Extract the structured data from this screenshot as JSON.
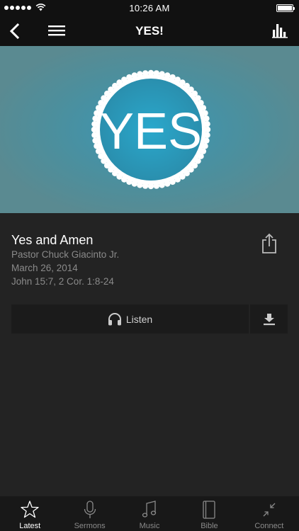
{
  "status": {
    "time": "10:26 AM"
  },
  "nav": {
    "title": "YES!"
  },
  "artwork": {
    "text": "YES",
    "background": "#568890",
    "circle": "#2e9fbf"
  },
  "sermon": {
    "title": "Yes and Amen",
    "speaker": "Pastor Chuck Giacinto Jr.",
    "date": "March 26, 2014",
    "scripture": "John 15:7, 2 Cor. 1:8-24",
    "listen_label": "Listen"
  },
  "tabs": [
    {
      "label": "Latest",
      "icon": "star-icon",
      "active": true
    },
    {
      "label": "Sermons",
      "icon": "microphone-icon",
      "active": false
    },
    {
      "label": "Music",
      "icon": "music-note-icon",
      "active": false
    },
    {
      "label": "Bible",
      "icon": "book-icon",
      "active": false
    },
    {
      "label": "Connect",
      "icon": "connect-arrows-icon",
      "active": false
    }
  ]
}
